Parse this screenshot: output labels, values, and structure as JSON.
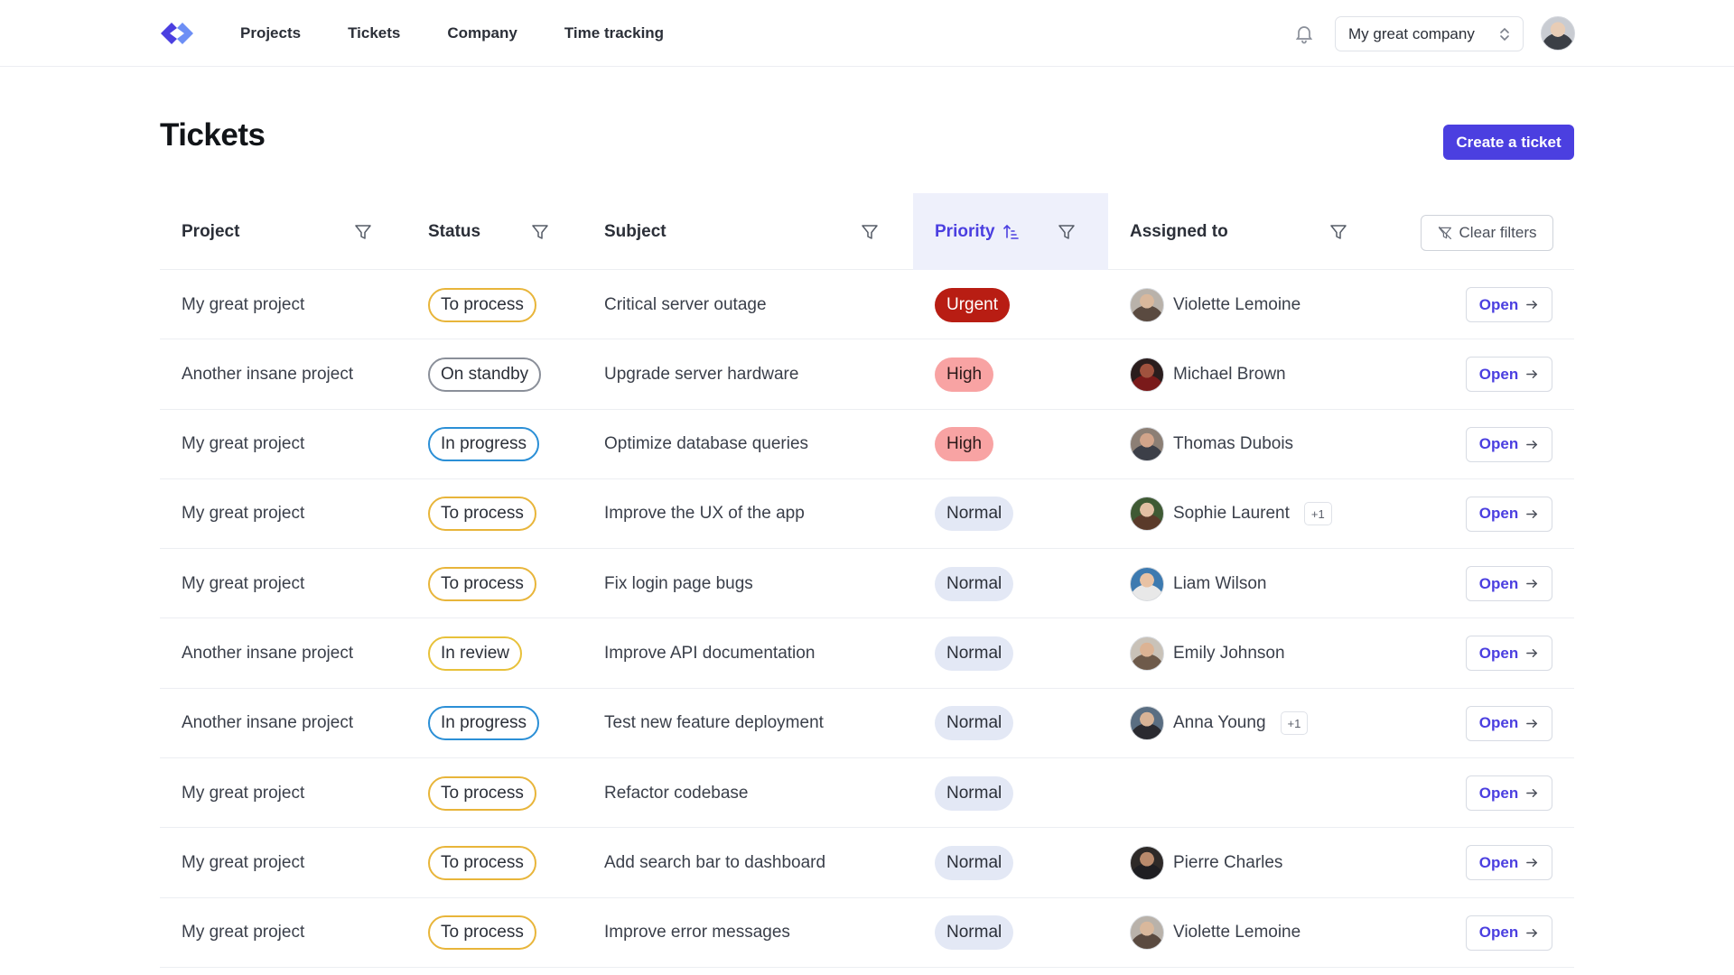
{
  "nav": {
    "items": [
      "Projects",
      "Tickets",
      "Company",
      "Time tracking"
    ],
    "company": "My great company"
  },
  "page": {
    "title": "Tickets",
    "create_label": "Create a ticket"
  },
  "table": {
    "headers": {
      "project": "Project",
      "status": "Status",
      "subject": "Subject",
      "priority": "Priority",
      "assigned": "Assigned to"
    },
    "clear_label": "Clear filters",
    "open_label": "Open",
    "rows": [
      {
        "project": "My great project",
        "status": "To process",
        "subject": "Critical server outage",
        "priority": "Urgent",
        "assignee": "Violette Lemoine",
        "extra": ""
      },
      {
        "project": "Another insane project",
        "status": "On standby",
        "subject": "Upgrade server hardware",
        "priority": "High",
        "assignee": "Michael Brown",
        "extra": ""
      },
      {
        "project": "My great project",
        "status": "In progress",
        "subject": "Optimize database queries",
        "priority": "High",
        "assignee": "Thomas Dubois",
        "extra": ""
      },
      {
        "project": "My great project",
        "status": "To process",
        "subject": "Improve the UX of the app",
        "priority": "Normal",
        "assignee": "Sophie Laurent",
        "extra": "+1"
      },
      {
        "project": "My great project",
        "status": "To process",
        "subject": "Fix login page bugs",
        "priority": "Normal",
        "assignee": "Liam Wilson",
        "extra": ""
      },
      {
        "project": "Another insane project",
        "status": "In review",
        "subject": "Improve API documentation",
        "priority": "Normal",
        "assignee": "Emily Johnson",
        "extra": ""
      },
      {
        "project": "Another insane project",
        "status": "In progress",
        "subject": "Test new feature deployment",
        "priority": "Normal",
        "assignee": "Anna Young",
        "extra": "+1"
      },
      {
        "project": "My great project",
        "status": "To process",
        "subject": "Refactor codebase",
        "priority": "Normal",
        "assignee": "",
        "extra": ""
      },
      {
        "project": "My great project",
        "status": "To process",
        "subject": "Add search bar to dashboard",
        "priority": "Normal",
        "assignee": "Pierre Charles",
        "extra": ""
      },
      {
        "project": "My great project",
        "status": "To process",
        "subject": "Improve error messages",
        "priority": "Normal",
        "assignee": "Violette Lemoine",
        "extra": ""
      }
    ]
  },
  "colors": {
    "accent": "#4b3fe0",
    "urgent": "#b81d13",
    "high": "#f8a3a3",
    "normal": "#e3e8f5",
    "to_process": "#e8b53a",
    "in_progress": "#2b8fd6",
    "on_standby": "#8a8f99"
  },
  "icons": [
    "logo-icon",
    "bell-icon",
    "chevron-updown-icon",
    "filter-icon",
    "sort-ascending-icon",
    "filter-off-icon",
    "arrow-right-icon"
  ]
}
